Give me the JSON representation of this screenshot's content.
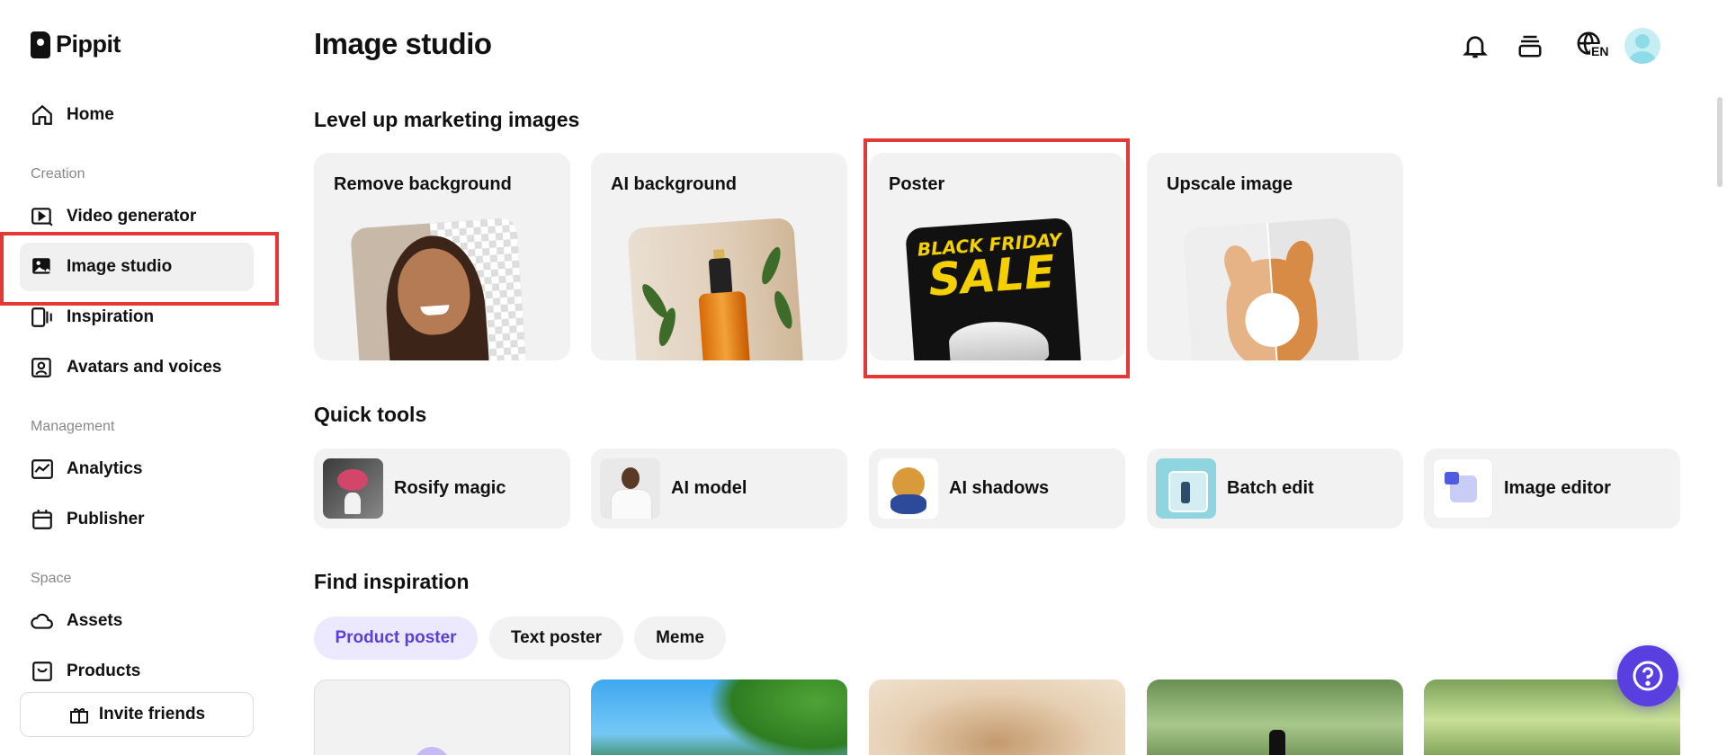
{
  "app": {
    "name": "Pippit"
  },
  "sidebar": {
    "items": [
      {
        "label": "Home"
      },
      {
        "label": "Video generator"
      },
      {
        "label": "Image studio"
      },
      {
        "label": "Inspiration"
      },
      {
        "label": "Avatars and voices"
      },
      {
        "label": "Analytics"
      },
      {
        "label": "Publisher"
      },
      {
        "label": "Assets"
      },
      {
        "label": "Products"
      }
    ],
    "sections": {
      "creation": "Creation",
      "management": "Management",
      "space": "Space"
    },
    "invite_label": "Invite friends",
    "active_item": "Image studio"
  },
  "header": {
    "title": "Image studio",
    "language": "EN",
    "icons": [
      "bell-icon",
      "stack-icon",
      "globe-language-icon",
      "avatar"
    ]
  },
  "marketing": {
    "title": "Level up marketing images",
    "cards": [
      {
        "label": "Remove background"
      },
      {
        "label": "AI background"
      },
      {
        "label": "Poster",
        "thumb_text_1": "BLACK FRIDAY",
        "thumb_text_2": "SALE"
      },
      {
        "label": "Upscale image"
      }
    ],
    "highlighted": "Poster"
  },
  "quick_tools": {
    "title": "Quick tools",
    "items": [
      {
        "label": "Rosify magic"
      },
      {
        "label": "AI model"
      },
      {
        "label": "AI shadows"
      },
      {
        "label": "Batch edit"
      },
      {
        "label": "Image editor"
      }
    ]
  },
  "inspiration": {
    "title": "Find inspiration",
    "tabs": [
      {
        "label": "Product poster",
        "active": true
      },
      {
        "label": "Text poster",
        "active": false
      },
      {
        "label": "Meme",
        "active": false
      }
    ]
  },
  "colors": {
    "accent": "#5a3fe0",
    "highlight_box": "#e53935",
    "active_tab_bg": "#ece8fd",
    "active_tab_text": "#5a3fd8"
  }
}
